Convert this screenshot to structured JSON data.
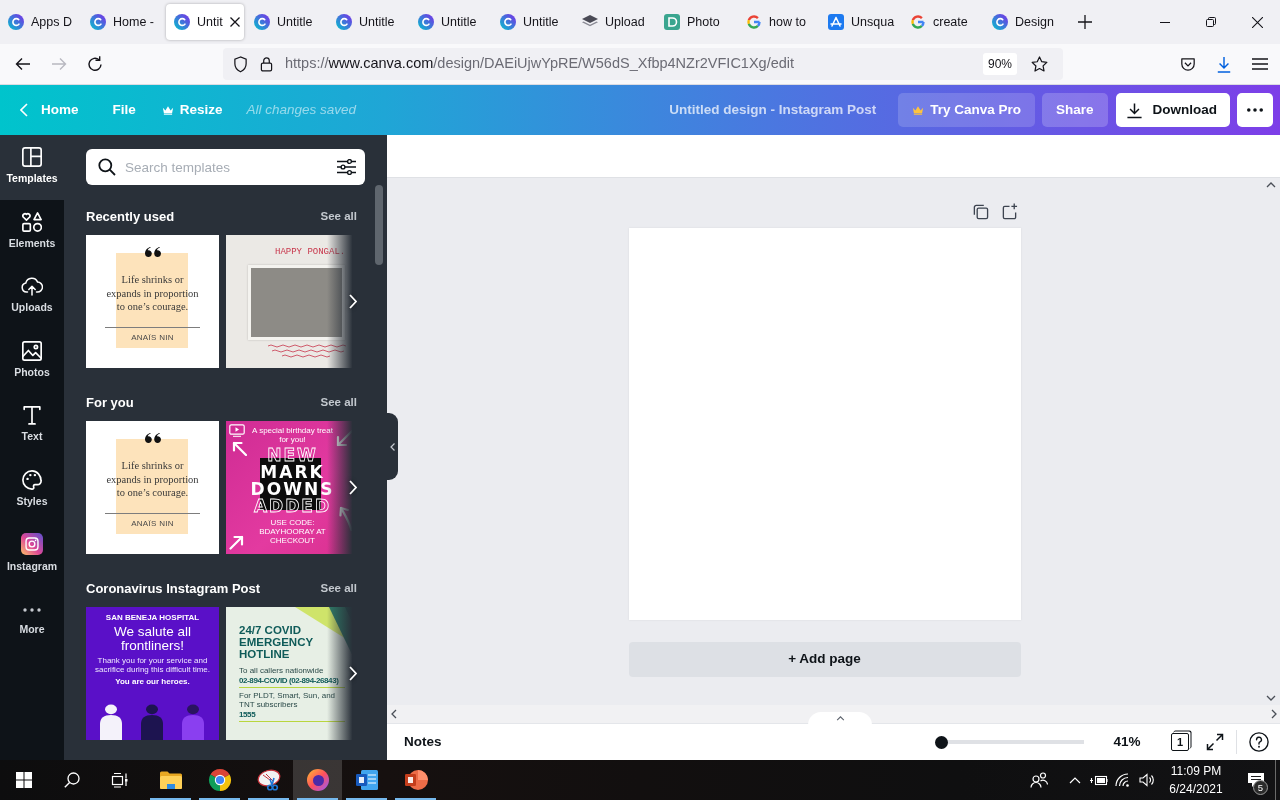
{
  "browser": {
    "tabs": [
      {
        "label": "Apps D",
        "kind": "canva",
        "selected": false
      },
      {
        "label": "Home -",
        "kind": "canva",
        "selected": false
      },
      {
        "label": "Untit",
        "kind": "canva",
        "selected": true
      },
      {
        "label": "Untitle",
        "kind": "canva",
        "selected": false
      },
      {
        "label": "Untitle",
        "kind": "canva",
        "selected": false
      },
      {
        "label": "Untitle",
        "kind": "canva",
        "selected": false
      },
      {
        "label": "Untitle",
        "kind": "canva",
        "selected": false
      },
      {
        "label": "Upload",
        "kind": "layers",
        "selected": false
      },
      {
        "label": "Photo",
        "kind": "tile",
        "selected": false
      },
      {
        "label": "how to",
        "kind": "google",
        "selected": false
      },
      {
        "label": "Unsqua",
        "kind": "store",
        "selected": false
      },
      {
        "label": "create",
        "kind": "google",
        "selected": false
      },
      {
        "label": "Design",
        "kind": "canva",
        "selected": false
      }
    ]
  },
  "address_bar": {
    "forward_disabled": true,
    "url_scheme": "https://",
    "url_host": "www.canva.com",
    "url_path": "/design/DAEiUjwYpRE/W56dS_Xfbp4NZr2VFIC1Xg/edit",
    "zoom": "90%"
  },
  "editor_header": {
    "home": "Home",
    "file": "File",
    "resize": "Resize",
    "save_status": "All changes saved",
    "design_title": "Untitled design - Instagram Post",
    "actions": [
      {
        "label": "Try Canva Pro",
        "kind": "pro"
      },
      {
        "label": "Share",
        "kind": "share"
      },
      {
        "label": "Download",
        "kind": "download"
      }
    ]
  },
  "sidebar": {
    "items": [
      {
        "label": "Templates",
        "kind": "templates",
        "selected": true
      },
      {
        "label": "Elements",
        "kind": "elements",
        "selected": false
      },
      {
        "label": "Uploads",
        "kind": "uploads",
        "selected": false
      },
      {
        "label": "Photos",
        "kind": "photos",
        "selected": false
      },
      {
        "label": "Text",
        "kind": "text",
        "selected": false
      },
      {
        "label": "Styles",
        "kind": "styles",
        "selected": false
      },
      {
        "label": "Instagram",
        "kind": "instagram",
        "selected": false
      },
      {
        "label": "More",
        "kind": "more",
        "selected": false
      }
    ]
  },
  "templates_panel": {
    "search": {
      "placeholder": "Search templates"
    },
    "sections": [
      {
        "title": "Recently used",
        "see_all": "See all",
        "templates": [
          {
            "kind": "quote",
            "quote": "Life shrinks or expands in proportion to one’s courage.",
            "author": "ANAÏS NIN"
          },
          {
            "kind": "pongal",
            "title": "HAPPY PONGAL."
          }
        ]
      },
      {
        "title": "For you",
        "see_all": "See all",
        "templates": [
          {
            "kind": "quote",
            "quote": "Life shrinks or expands in proportion to one’s courage.",
            "author": "ANAÏS NIN"
          },
          {
            "kind": "sale",
            "kicker": "A special birthday treat for you!",
            "lines": [
              "NEW",
              "MARK",
              "DOWNS",
              "ADDED"
            ],
            "code": "USE CODE: BDAYHOORAY AT CHECKOUT"
          }
        ]
      },
      {
        "title": "Coronavirus Instagram Post",
        "see_all": "See all",
        "templates": [
          {
            "kind": "salute",
            "hospital": "SAN BENEJA HOSPITAL",
            "headline": "We salute all frontliners!",
            "message": "Thank you for your service and sacrifice during this difficult time.",
            "tagline": "You are our heroes."
          },
          {
            "kind": "hotline",
            "headline": "24/7 COVID EMERGENCY HOTLINE",
            "note_1": "To all callers nationwide",
            "number_1": "02-894-COVID (02-894-26843)",
            "note_2": "For PLDT, Smart, Sun, and TNT subscribers",
            "number_2": "1555"
          }
        ]
      }
    ]
  },
  "canvas": {
    "add_page": "+ Add page"
  },
  "footer": {
    "notes": "Notes",
    "zoom": {
      "level": 0.04,
      "reading": "41%"
    },
    "page_count": "1"
  },
  "taskbar": {
    "apps": [
      {
        "kind": "explorer",
        "running": true,
        "selected": false
      },
      {
        "kind": "chrome",
        "running": true,
        "selected": false
      },
      {
        "kind": "snipping",
        "running": true,
        "selected": false
      },
      {
        "kind": "firefox",
        "running": true,
        "selected": true
      },
      {
        "kind": "word",
        "running": true,
        "selected": false
      },
      {
        "kind": "powerpoint",
        "running": true,
        "selected": false
      }
    ],
    "time": "11:09 PM",
    "date": "6/24/2021",
    "notifications": "5"
  }
}
